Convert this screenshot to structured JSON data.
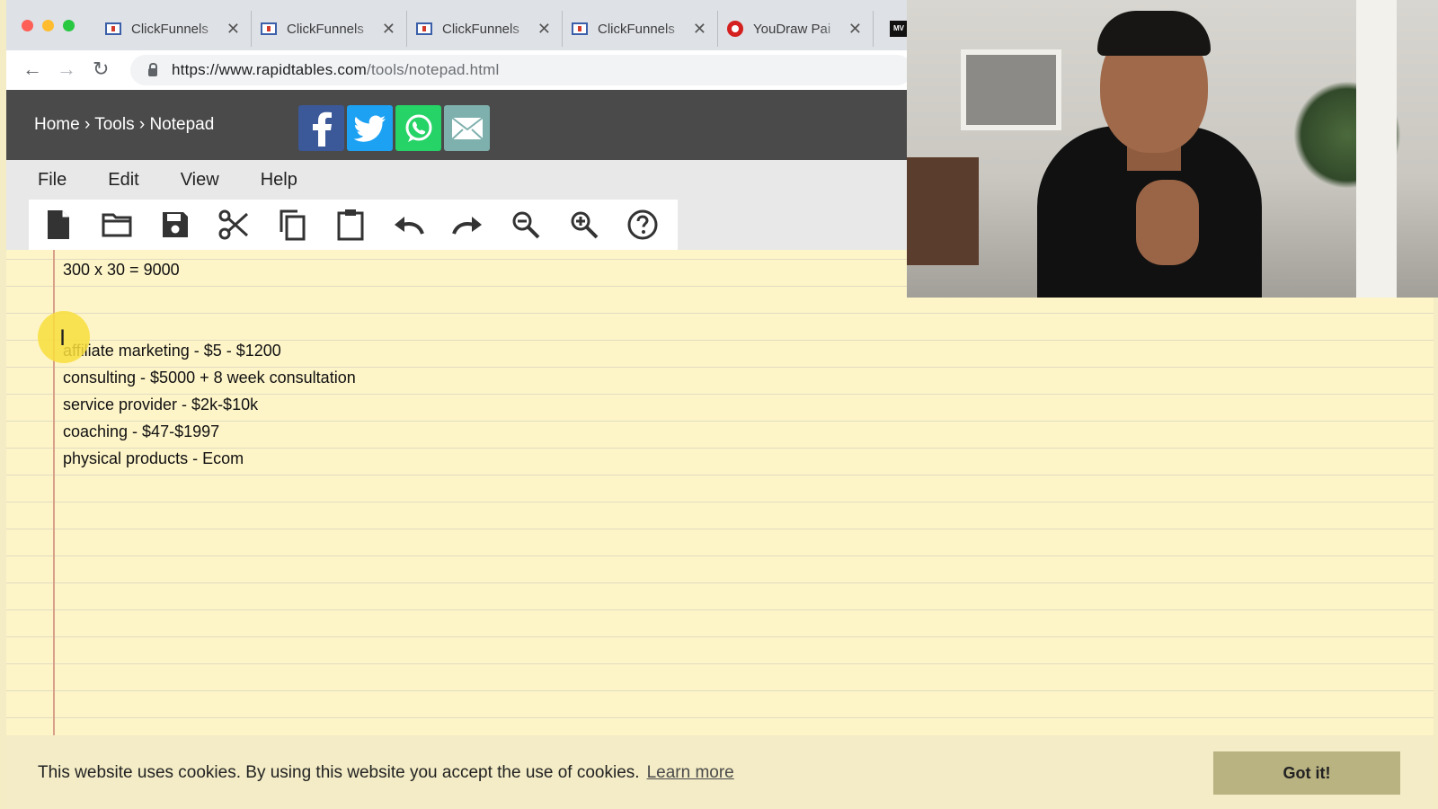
{
  "browser": {
    "tabs": [
      {
        "title": "ClickFunnels",
        "icon": "clickfunnels-icon"
      },
      {
        "title": "ClickFunnels",
        "icon": "clickfunnels-icon"
      },
      {
        "title": "ClickFunnels",
        "icon": "clickfunnels-icon"
      },
      {
        "title": "ClickFunnels",
        "icon": "clickfunnels-icon"
      },
      {
        "title": "YouDraw Pai",
        "icon": "youidraw-icon"
      }
    ],
    "close_glyph": "✕",
    "extra_tab_icon_text": "MV",
    "url_host": "https://www.rapidtables.com",
    "url_path": "/tools/notepad.html"
  },
  "site": {
    "breadcrumb": "Home › Tools › Notepad",
    "share_buttons": [
      "facebook-icon",
      "twitter-icon",
      "whatsapp-icon",
      "email-icon"
    ],
    "colors": {
      "header_bg": "#4a4a4a",
      "facebook": "#3b5998",
      "twitter": "#1da1f2",
      "whatsapp": "#25d366",
      "email": "#7eb0ad"
    }
  },
  "menu": [
    "File",
    "Edit",
    "View",
    "Help"
  ],
  "toolbar_icons": [
    "new-file-icon",
    "open-folder-icon",
    "save-icon",
    "cut-icon",
    "copy-icon",
    "paste-icon",
    "undo-icon",
    "redo-icon",
    "zoom-out-icon",
    "zoom-in-icon",
    "help-icon"
  ],
  "notepad": {
    "lines": [
      "300 x 30 = 9000",
      "",
      "",
      "affiliate marketing - $5 - $1200",
      "consulting - $5000 + 8 week consultation",
      "service provider - $2k-$10k",
      "coaching - $47-$1997",
      "physical products - Ecom"
    ],
    "paper_color": "#fdf4c8",
    "margin_color": "#d9a08a"
  },
  "cookie": {
    "text": "This website uses cookies. By using this website you accept the use of cookies.",
    "link": "Learn more",
    "button": "Got it!"
  }
}
